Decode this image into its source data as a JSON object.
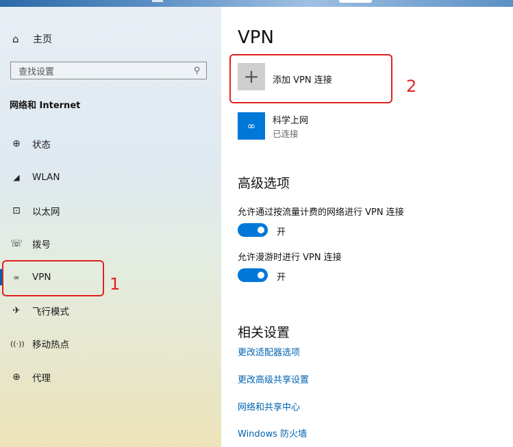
{
  "colors": {
    "accent": "#0078d7",
    "link": "#0063b1",
    "annotation": "#e02020"
  },
  "sidebar": {
    "home_icon": "home-icon",
    "home_label": "主页",
    "search_placeholder": "查找设置",
    "search_icon": "search-icon",
    "section_title": "网络和 Internet",
    "items": [
      {
        "icon": "status-globe-icon",
        "label": "状态"
      },
      {
        "icon": "wifi-icon",
        "label": "WLAN"
      },
      {
        "icon": "ethernet-icon",
        "label": "以太网"
      },
      {
        "icon": "dialup-icon",
        "label": "拨号"
      },
      {
        "icon": "vpn-icon",
        "label": "VPN",
        "selected": true
      },
      {
        "icon": "airplane-icon",
        "label": "飞行模式"
      },
      {
        "icon": "hotspot-icon",
        "label": "移动热点"
      },
      {
        "icon": "proxy-globe-icon",
        "label": "代理"
      }
    ]
  },
  "main": {
    "title": "VPN",
    "add_vpn_label": "添加 VPN 连接",
    "connection": {
      "name": "科学上网",
      "status": "已连接",
      "icon": "vpn-icon"
    },
    "advanced_title": "高级选项",
    "options": [
      {
        "label": "允许通过按流量计费的网络进行 VPN 连接",
        "toggle": "开",
        "on": true
      },
      {
        "label": "允许漫游时进行 VPN 连接",
        "toggle": "开",
        "on": true
      }
    ],
    "related_title": "相关设置",
    "links": [
      "更改适配器选项",
      "更改高级共享设置",
      "网络和共享中心",
      "Windows 防火墙"
    ]
  },
  "annotations": [
    "1",
    "2"
  ]
}
